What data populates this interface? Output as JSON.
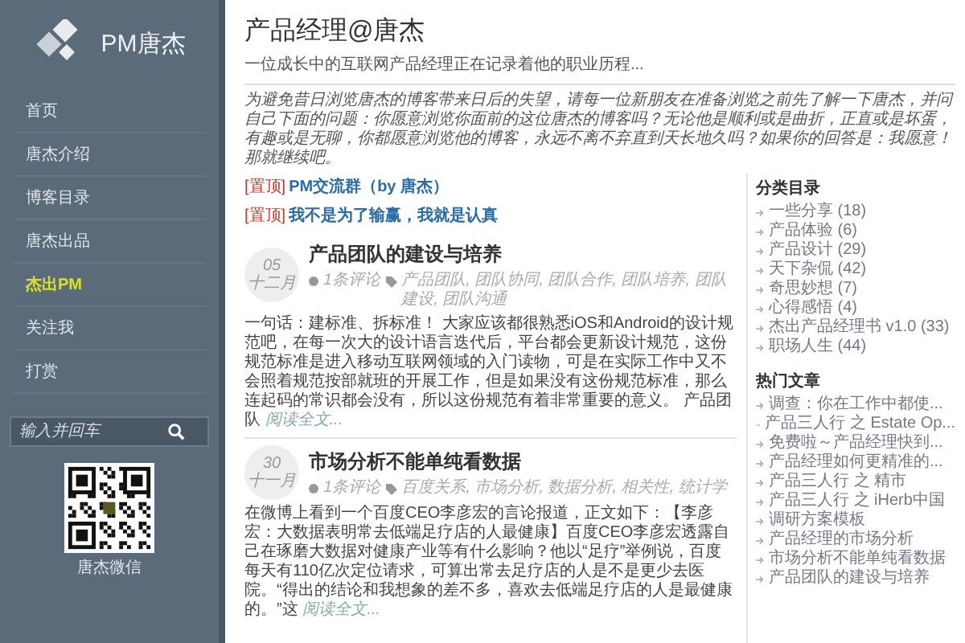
{
  "logo": {
    "text": "PM唐杰"
  },
  "nav": [
    {
      "label": "首页",
      "selected": false
    },
    {
      "label": "唐杰介绍",
      "selected": false
    },
    {
      "label": "博客目录",
      "selected": false
    },
    {
      "label": "唐杰出品",
      "selected": false
    },
    {
      "label": "杰出PM",
      "selected": true
    },
    {
      "label": "关注我",
      "selected": false
    },
    {
      "label": "打赏",
      "selected": false
    }
  ],
  "search": {
    "placeholder": "输入并回车"
  },
  "qr": {
    "caption": "唐杰微信"
  },
  "header": {
    "title": "产品经理@唐杰",
    "subtitle": "一位成长中的互联网产品经理正在记录着他的职业历程...",
    "intro": "为避免昔日浏览唐杰的博客带来日后的失望，请每一位新朋友在准备浏览之前先了解一下唐杰，并问自己下面的问题：你愿意浏览你面前的这位唐杰的博客吗？无论他是顺利或是曲折，正直或是坏蛋，有趣或是无聊，你都愿意浏览他的博客，永远不离不弃直到天长地久吗？如果你的回答是：我愿意！那就继续吧。"
  },
  "pinned": [
    {
      "tag": "[置顶]",
      "title": "PM交流群（by 唐杰）"
    },
    {
      "tag": "[置顶]",
      "title": "我不是为了输赢，我就是认真"
    }
  ],
  "posts": [
    {
      "day": "05",
      "month": "十二月",
      "title": "产品团队的建设与培养",
      "comments": "1条评论",
      "tags": "产品团队, 团队协同, 团队合作, 团队培养, 团队建设, 团队沟通",
      "excerpt": "一句话：建标准、拆标准！ 大家应该都很熟悉iOS和Android的设计规范吧，在每一次大的设计语言迭代后，平台都会更新设计规范，这份规范标准是进入移动互联网领域的入门读物，可是在实际工作中又不会照着规范按部就班的开展工作，但是如果没有这份规范标准，那么连起码的常识都会没有，所以这份规范有着非常重要的意义。 产品团队",
      "more": "阅读全文..."
    },
    {
      "day": "30",
      "month": "十一月",
      "title": "市场分析不能单纯看数据",
      "comments": "1条评论",
      "tags": "百度关系, 市场分析, 数据分析, 相关性, 统计学",
      "excerpt": "在微博上看到一个百度CEO李彦宏的言论报道，正文如下：【李彦宏：大数据表明常去低端足疗店的人最健康】百度CEO李彦宏透露自己在琢磨大数据对健康产业等有什么影响？他以“足疗”举例说，百度每天有110亿次定位请求，可算出常去足疗店的人是不是更少去医院。“得出的结论和我想象的差不多，喜欢去低端足疗店的人是最健康的。”这",
      "more": "阅读全文..."
    }
  ],
  "categories": {
    "title": "分类目录",
    "items": [
      "一些分享 (18)",
      "产品体验 (6)",
      "产品设计 (29)",
      "天下杂侃 (42)",
      "奇思妙想 (7)",
      "心得感悟 (4)",
      "杰出产品经理书 v1.0 (33)",
      "职场人生 (44)"
    ]
  },
  "hot": {
    "title": "热门文章",
    "items": [
      "调查：你在工作中都使...",
      "产品三人行 之 Estate Op...",
      "免费啦～产品经理快到...",
      "产品经理如何更精准的...",
      "产品三人行 之 精市",
      "产品三人行 之 iHerb中国",
      "调研方案模板",
      "产品经理的市场分析",
      "市场分析不能单纯看数据",
      "产品团队的建设与培养"
    ]
  }
}
